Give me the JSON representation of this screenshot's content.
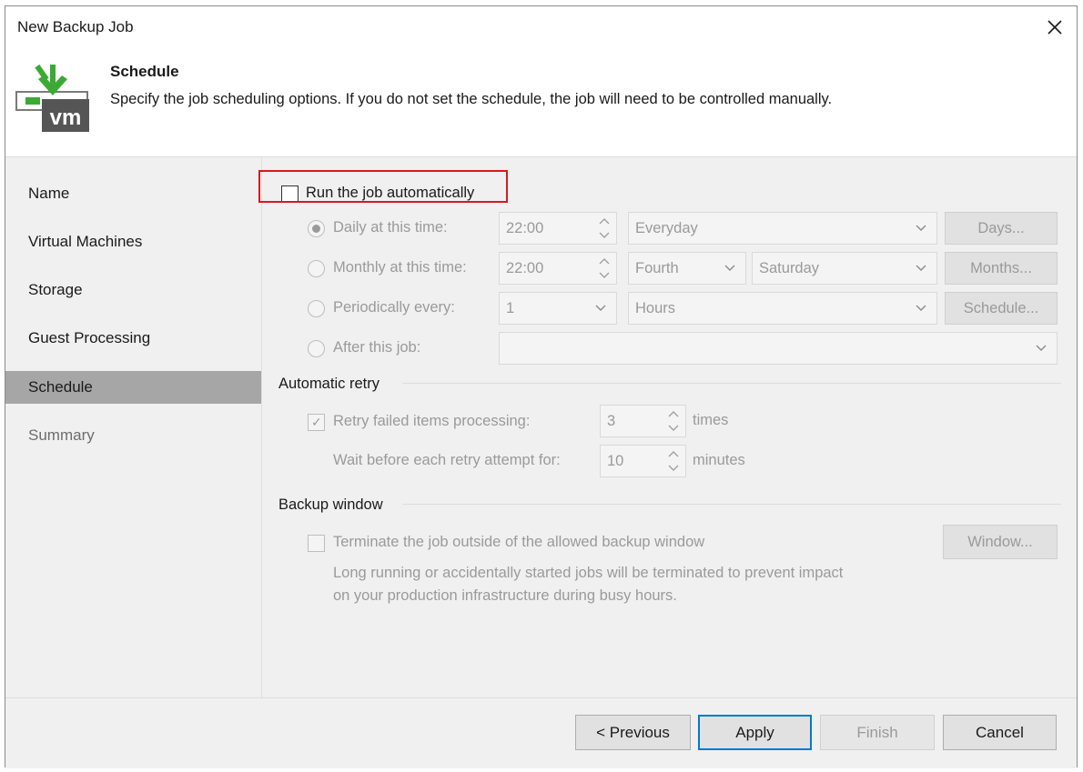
{
  "window": {
    "title": "New Backup Job"
  },
  "header": {
    "title": "Schedule",
    "description": "Specify the job scheduling options. If you do not set the schedule, the job will need to be controlled manually.",
    "icon": "vm-backup-icon",
    "icon_text": "vm"
  },
  "nav": {
    "items": [
      {
        "label": "Name",
        "state": "normal"
      },
      {
        "label": "Virtual Machines",
        "state": "normal"
      },
      {
        "label": "Storage",
        "state": "normal"
      },
      {
        "label": "Guest Processing",
        "state": "normal"
      },
      {
        "label": "Schedule",
        "state": "active"
      },
      {
        "label": "Summary",
        "state": "disabled"
      }
    ]
  },
  "schedule": {
    "run_automatically": {
      "label": "Run the job automatically",
      "checked": false
    },
    "daily": {
      "label": "Daily at this time:",
      "time": "22:00",
      "days": "Everyday",
      "button": "Days...",
      "selected": true
    },
    "monthly": {
      "label": "Monthly at this time:",
      "time": "22:00",
      "week": "Fourth",
      "day": "Saturday",
      "button": "Months...",
      "selected": false
    },
    "periodically": {
      "label": "Periodically every:",
      "value": "1",
      "unit": "Hours",
      "button": "Schedule...",
      "selected": false
    },
    "after_job": {
      "label": "After this job:",
      "value": "",
      "selected": false
    }
  },
  "retry": {
    "title": "Automatic retry",
    "retry_label": "Retry failed items processing:",
    "retry_checked": true,
    "retry_count": "3",
    "retry_unit": "times",
    "wait_label": "Wait before each retry attempt for:",
    "wait_value": "10",
    "wait_unit": "minutes"
  },
  "backup_window": {
    "title": "Backup window",
    "terminate_label": "Terminate the job outside of the allowed backup window",
    "terminate_checked": false,
    "button": "Window...",
    "note_line1": "Long running or accidentally started jobs will be terminated to prevent impact",
    "note_line2": "on your production infrastructure during busy hours."
  },
  "footer": {
    "previous": "< Previous",
    "apply": "Apply",
    "finish": "Finish",
    "cancel": "Cancel"
  },
  "colors": {
    "accent": "#0078d7",
    "highlight": "#d9181c",
    "brand_green": "#3aaa35",
    "vm_gray": "#555555"
  }
}
